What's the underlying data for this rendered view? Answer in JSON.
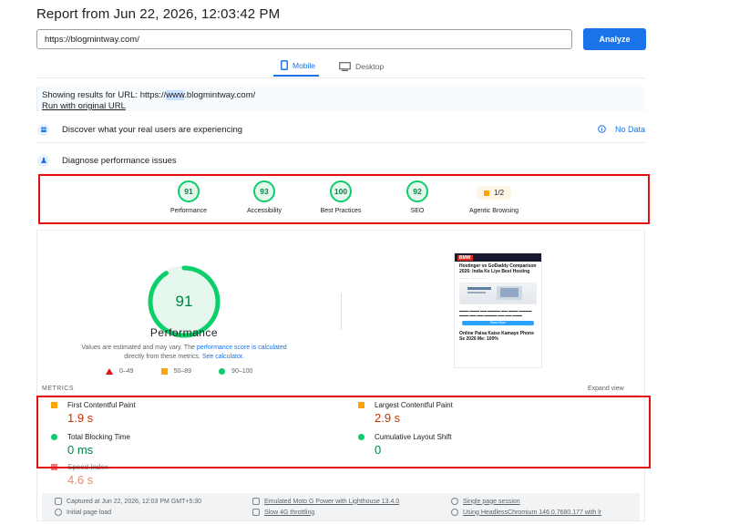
{
  "header": {
    "title": "Report from Jun 22, 2026, 12:03:42 PM",
    "url_value": "https://blogmintway.com/",
    "analyze_label": "Analyze"
  },
  "tabs": [
    {
      "label": "Mobile",
      "active": true,
      "icon": "phone-icon"
    },
    {
      "label": "Desktop",
      "active": false,
      "icon": "desktop-icon"
    }
  ],
  "results": {
    "prefix": "Showing results for URL: https://",
    "highlight": "www",
    "suffix": ".blogmintway.com/",
    "run_original": "Run with original URL"
  },
  "sections": {
    "discover": "Discover what your real users are experiencing",
    "no_data": "No Data",
    "diagnose": "Diagnose performance issues"
  },
  "scores": [
    {
      "label": "Performance",
      "value": "91"
    },
    {
      "label": "Accessibility",
      "value": "93"
    },
    {
      "label": "Best Practices",
      "value": "100"
    },
    {
      "label": "SEO",
      "value": "92"
    }
  ],
  "agentic": {
    "label": "Agentic Browsing",
    "value": "1/2"
  },
  "performance": {
    "score": "91",
    "score_value": 91,
    "title": "Performance",
    "note_a": "Values are estimated and may vary. The ",
    "note_link": "performance score is calculated",
    "note_b": "directly from these metrics. ",
    "note_calc": "See calculator.",
    "legend": [
      "0–49",
      "50–89",
      "90–100"
    ]
  },
  "thumbnail": {
    "logo": "BMW",
    "headline": "Hostinger vs GoDaddy Comparison 2026: India Ke Liye Best Hosting",
    "button": "Read More",
    "footer_headline": "Online Paisa Kaise Kamaye Phone Se 2026 Me: 100%"
  },
  "metrics": {
    "header": "METRICS",
    "expand": "Expand view",
    "items": [
      {
        "name": "First Contentful Paint",
        "value": "1.9 s"
      },
      {
        "name": "Largest Contentful Paint",
        "value": "2.9 s"
      },
      {
        "name": "Total Blocking Time",
        "value": "0 ms"
      },
      {
        "name": "Cumulative Layout Shift",
        "value": "0"
      },
      {
        "name": "Speed Index",
        "value": "4.6 s"
      }
    ]
  },
  "footer": {
    "captured": "Captured at Jun 22, 2026, 12:03 PM GMT+5:30",
    "initial": "Initial page load",
    "emulated": "Emulated Moto G Power with Lighthouse 13.4.0",
    "throttling": "Slow 4G throttling",
    "session": "Single page session",
    "chromium": "Using HeadlessChromium 146.0.7680.177 with lr"
  },
  "colors": {
    "accent": "#1a73e8",
    "pass": "#0cce6b",
    "average": "#ffa400",
    "fail": "#e01010",
    "highlight_frame": "#e01010"
  }
}
